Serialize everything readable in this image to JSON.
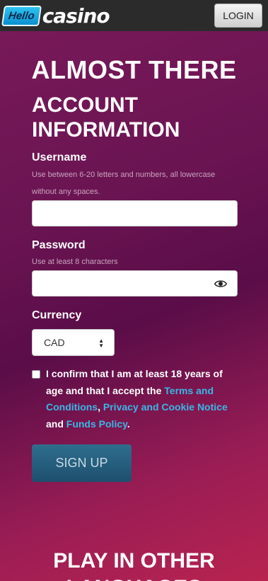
{
  "header": {
    "logo_hello": "Hello",
    "logo_casino": "casino",
    "login_label": "LOGIN"
  },
  "titles": {
    "main": "ALMOST THERE",
    "sub": "ACCOUNT INFORMATION",
    "bottom": "PLAY IN OTHER LANGUAGES"
  },
  "form": {
    "username": {
      "label": "Username",
      "hint": "Use between 6-20 letters and numbers, all lowercase without any spaces.",
      "value": ""
    },
    "password": {
      "label": "Password",
      "hint": "Use at least 8 characters",
      "value": "",
      "icon": "eye-icon"
    },
    "currency": {
      "label": "Currency",
      "selected": "CAD"
    },
    "terms": {
      "checked": false,
      "text_1": "I confirm that I am at least 18 years of age and that I accept the ",
      "link_terms": "Terms and Conditions",
      "sep_1": ", ",
      "link_privacy": "Privacy and Cookie Notice",
      "sep_2": " and ",
      "link_funds": "Funds Policy",
      "end": "."
    },
    "signup_label": "SIGN UP"
  },
  "colors": {
    "link": "#3cb6e6",
    "signup_bg": "#2a6584",
    "topbar": "#2b2b2b"
  }
}
